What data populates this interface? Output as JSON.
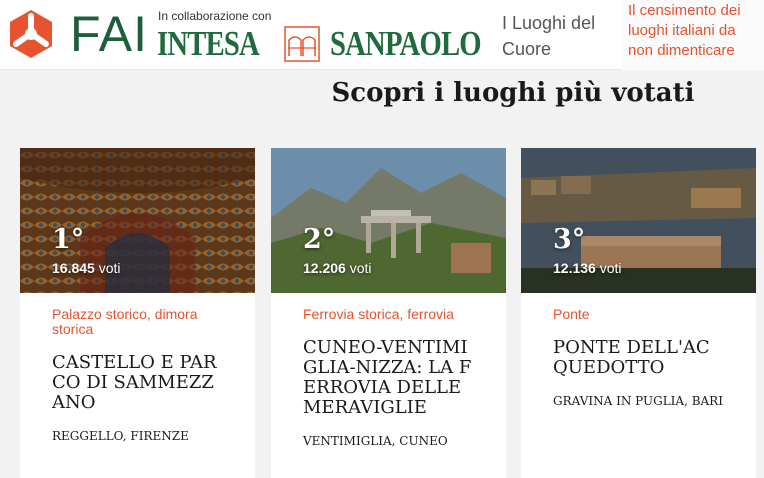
{
  "header": {
    "brand": "FAI",
    "collab_label": "In collaborazione con",
    "partner_1": "INTESA",
    "partner_2": "SANPAOLO",
    "site_title": "I Luoghi del Cuore",
    "tagline": "Il censimento dei luoghi italiani da non dimenticare"
  },
  "section": {
    "title": "Scopri i luoghi più votati"
  },
  "cards": [
    {
      "rank": "1°",
      "votes_count": "16.845",
      "votes_unit": "voti",
      "category": "Palazzo storico, dimora storica",
      "name": "Castello e Parco di Sammezzano",
      "location": "Reggello, Firenze"
    },
    {
      "rank": "2°",
      "votes_count": "12.206",
      "votes_unit": "voti",
      "category": "Ferrovia storica, ferrovia",
      "name": "Cuneo-Ventimiglia-Nizza: la ferrovia delle meraviglie",
      "location": "Ventimiglia, Cuneo"
    },
    {
      "rank": "3°",
      "votes_count": "12.136",
      "votes_unit": "voti",
      "category": "Ponte",
      "name": "Ponte dell'acquedotto",
      "location": "Gravina in Puglia, Bari"
    }
  ],
  "colors": {
    "brand_green": "#1f5e3a",
    "accent_orange": "#e6532e"
  }
}
